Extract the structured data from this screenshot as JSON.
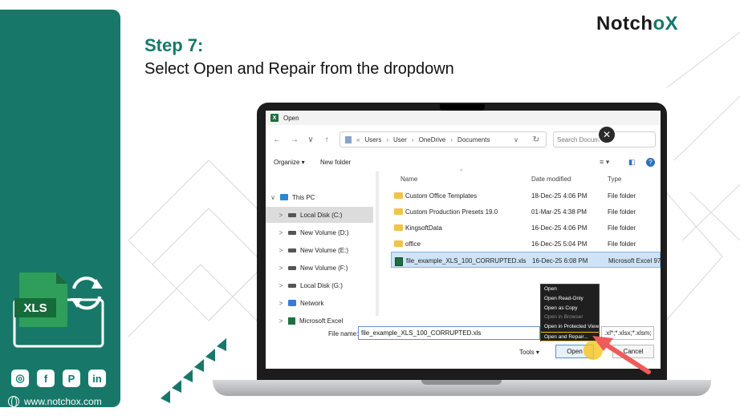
{
  "brand": {
    "prefix": "Notch",
    "accent": "X",
    "mid": "o"
  },
  "headline": {
    "step": "Step 7:",
    "subtitle": "Select Open and Repair from the dropdown"
  },
  "sidebar": {
    "xls_label": "XLS",
    "website": "www.notchox.com",
    "socials": [
      {
        "name": "instagram-icon",
        "glyph": "◎"
      },
      {
        "name": "facebook-icon",
        "glyph": "f"
      },
      {
        "name": "pinterest-icon",
        "glyph": "P"
      },
      {
        "name": "linkedin-icon",
        "glyph": "in"
      }
    ]
  },
  "dialog": {
    "title": "Open",
    "address": {
      "parts": [
        "«",
        "Users",
        "›",
        "User",
        "›",
        "OneDrive",
        "›",
        "Documents"
      ],
      "search_placeholder": "Search Docume..."
    },
    "toolbar": {
      "organize": "Organize ▾",
      "new_folder": "New folder"
    },
    "nav": [
      {
        "label": "This PC",
        "chevron": "∨",
        "icon": "pc"
      },
      {
        "label": "Local Disk (C:)",
        "chevron": ">",
        "icon": "drive"
      },
      {
        "label": "New Volume (D:)",
        "chevron": ">",
        "icon": "drive"
      },
      {
        "label": "New Volume (E:)",
        "chevron": ">",
        "icon": "drive"
      },
      {
        "label": "New Volume (F:)",
        "chevron": ">",
        "icon": "drive"
      },
      {
        "label": "Local Disk (G:)",
        "chevron": ">",
        "icon": "drive"
      },
      {
        "label": "Network",
        "chevron": ">",
        "icon": "network"
      },
      {
        "label": "Microsoft Excel",
        "chevron": ">",
        "icon": "excel"
      }
    ],
    "columns": {
      "name": "Name",
      "date": "Date modified",
      "type": "Type"
    },
    "files": [
      {
        "name": "Custom Office Templates",
        "date": "18-Dec-25 4:06 PM",
        "type": "File folder",
        "icon": "folder"
      },
      {
        "name": "Custom Production Presets 19.0",
        "date": "01-Mar-25 4:38 PM",
        "type": "File folder",
        "icon": "folder"
      },
      {
        "name": "KingsoftData",
        "date": "16-Dec-25 4:06 PM",
        "type": "File folder",
        "icon": "folder"
      },
      {
        "name": "office",
        "date": "16-Dec-25 5:04 PM",
        "type": "File folder",
        "icon": "folder"
      },
      {
        "name": "file_example_XLS_100_CORRUPTED.xls",
        "date": "16-Dec-25 6:08 PM",
        "type": "Microsoft Excel 97...",
        "icon": "excel"
      }
    ],
    "file_name_label": "File name:",
    "file_name_value": "file_example_XLS_100_CORRUPTED.xls",
    "file_type_value": ".xl*;*.xlsx;*.xlsm;",
    "tools": "Tools ▾",
    "open_label": "Open",
    "cancel_label": "Cancel",
    "menu": [
      {
        "label": "Open",
        "state": "normal"
      },
      {
        "label": "Open Read-Only",
        "state": "normal"
      },
      {
        "label": "Open as Copy",
        "state": "normal"
      },
      {
        "label": "Open in Browser",
        "state": "disabled"
      },
      {
        "label": "Open in Protected View",
        "state": "normal"
      },
      {
        "label": "Open and Repair...",
        "state": "highlighted"
      }
    ]
  },
  "colors": {
    "teal": "#17786a",
    "arrow": "#ef5b5b",
    "highlight": "#f0c400"
  }
}
